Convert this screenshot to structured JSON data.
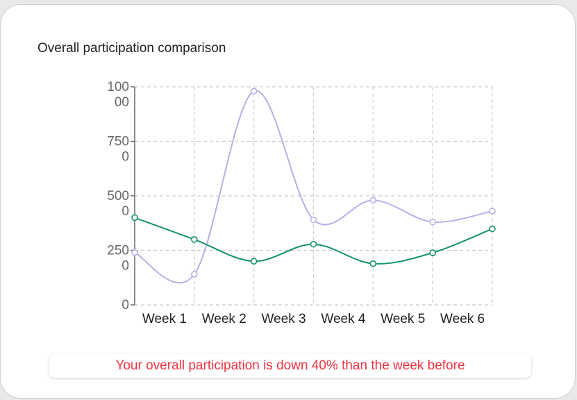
{
  "card": {
    "title": "Overall participation comparison"
  },
  "status": {
    "message": "Your overall participation is down 40% than the week before",
    "color": "#ef3340"
  },
  "chart_data": {
    "type": "line",
    "title": "Overall participation comparison",
    "xlabel": "",
    "ylabel": "",
    "categories": [
      "Week 1",
      "Week 2",
      "Week 3",
      "Week 4",
      "Week 5",
      "Week 6"
    ],
    "x_positions": [
      "",
      "Week 1",
      "Week 2",
      "Week 3",
      "Week 4",
      "Week 5",
      "Week 6"
    ],
    "yticks": [
      {
        "value": 0,
        "lines": [
          "0"
        ]
      },
      {
        "value": 2500,
        "lines": [
          "250",
          "0"
        ]
      },
      {
        "value": 5000,
        "lines": [
          "500",
          "0"
        ]
      },
      {
        "value": 7500,
        "lines": [
          "750",
          "0"
        ]
      },
      {
        "value": 10000,
        "lines": [
          "100",
          "00"
        ]
      }
    ],
    "ylim": [
      0,
      10000
    ],
    "grid": true,
    "legend": "none",
    "series": [
      {
        "color": "#b9aeea",
        "values": [
          2400,
          1400,
          9800,
          3900,
          4800,
          3800,
          4300
        ]
      },
      {
        "color": "#14936b",
        "values": [
          4000,
          3000,
          2000,
          2780,
          1890,
          2390,
          3490
        ]
      }
    ]
  }
}
